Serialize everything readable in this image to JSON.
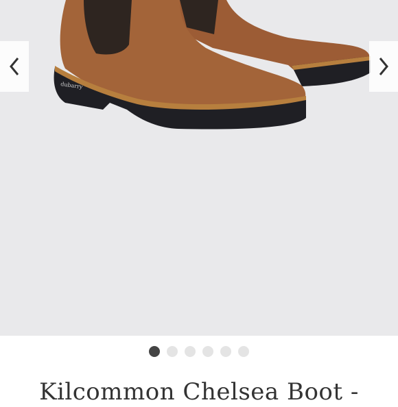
{
  "gallery": {
    "image_alt": "Kilcommon Chelsea Boot - brown suede chelsea boots",
    "image_count": 6,
    "active_index": 0,
    "prev_icon": "chevron-left-icon",
    "next_icon": "chevron-right-icon",
    "colors": {
      "background": "#e9e9eb",
      "boot_leather": "#a0613a",
      "elastic": "#2e2520",
      "sole": "#1f1f24",
      "welt": "#b77f3e",
      "active_dot": "#444444",
      "inactive_dot": "#e4e4e4"
    }
  },
  "product": {
    "title": "Kilcommon Chelsea Boot -"
  }
}
